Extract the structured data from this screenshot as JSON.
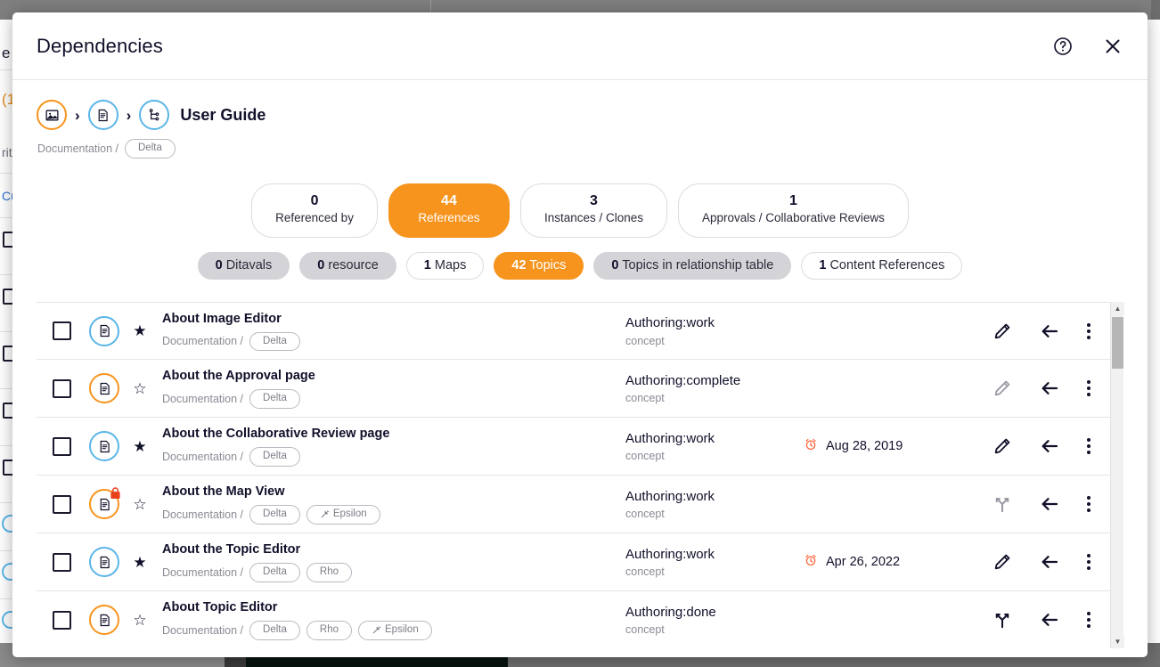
{
  "modal": {
    "title": "Dependencies",
    "help_icon": "help-circle-icon",
    "close_icon": "close-icon"
  },
  "breadcrumb": {
    "items": [
      {
        "icon": "image-icon",
        "ring": "#f7941e"
      },
      {
        "icon": "document-icon",
        "ring": "#5bb6e8"
      },
      {
        "icon": "map-branch-icon",
        "ring": "#5bb6e8"
      }
    ],
    "separator": "›",
    "title": "User Guide",
    "path": "Documentation /",
    "tag": "Delta"
  },
  "stats": [
    {
      "count": "0",
      "label": "Referenced by",
      "active": false
    },
    {
      "count": "44",
      "label": "References",
      "active": true
    },
    {
      "count": "3",
      "label": "Instances / Clones",
      "active": false
    },
    {
      "count": "1",
      "label": "Approvals / Collaborative Reviews",
      "active": false
    }
  ],
  "chips": [
    {
      "count": "0",
      "label": "Ditavals",
      "style": "grey"
    },
    {
      "count": "0",
      "label": "resource",
      "style": "grey"
    },
    {
      "count": "1",
      "label": "Maps",
      "style": "plain"
    },
    {
      "count": "42",
      "label": "Topics",
      "style": "orange"
    },
    {
      "count": "0",
      "label": "Topics in relationship table",
      "style": "grey"
    },
    {
      "count": "1",
      "label": "Content References",
      "style": "plain"
    }
  ],
  "table": {
    "rows": [
      {
        "name": "About Image Editor",
        "path": "Documentation /",
        "tags": [
          "Delta"
        ],
        "ring": "#5bb6e8",
        "locked": false,
        "starred": true,
        "status": "Authoring:work",
        "type": "concept",
        "date": "",
        "edit_enabled": true,
        "branch_enabled": false
      },
      {
        "name": "About the Approval page",
        "path": "Documentation /",
        "tags": [
          "Delta"
        ],
        "ring": "#f7941e",
        "locked": false,
        "starred": false,
        "status": "Authoring:complete",
        "type": "concept",
        "date": "",
        "edit_enabled": false,
        "branch_enabled": false
      },
      {
        "name": "About the Collaborative Review page",
        "path": "Documentation /",
        "tags": [
          "Delta"
        ],
        "ring": "#5bb6e8",
        "locked": false,
        "starred": true,
        "status": "Authoring:work",
        "type": "concept",
        "date": "Aug 28, 2019",
        "edit_enabled": true,
        "branch_enabled": false
      },
      {
        "name": "About the Map View",
        "path": "Documentation /",
        "tags": [
          "Delta",
          "Epsilon"
        ],
        "ring": "#f7941e",
        "locked": true,
        "starred": false,
        "status": "Authoring:work",
        "type": "concept",
        "date": "",
        "edit_enabled": false,
        "branch_enabled": false,
        "branch_dim": true
      },
      {
        "name": "About the Topic Editor",
        "path": "Documentation /",
        "tags": [
          "Delta",
          "Rho"
        ],
        "ring": "#5bb6e8",
        "locked": false,
        "starred": true,
        "status": "Authoring:work",
        "type": "concept",
        "date": "Apr 26, 2022",
        "edit_enabled": true,
        "branch_enabled": false
      },
      {
        "name": "About Topic Editor",
        "path": "Documentation /",
        "tags": [
          "Delta",
          "Rho",
          "Epsilon"
        ],
        "ring": "#f7941e",
        "locked": false,
        "starred": false,
        "status": "Authoring:done",
        "type": "concept",
        "date": "",
        "edit_enabled": false,
        "branch_enabled": true
      }
    ],
    "icons": {
      "edit": "pencil-icon",
      "branch": "branch-merge-icon",
      "back": "arrow-left-into-icon",
      "more": "kebab-menu-icon",
      "alarm": "alarm-clock-icon"
    }
  },
  "background": {
    "texts": [
      "e",
      "(1",
      "rite",
      "Cu"
    ]
  },
  "colors": {
    "accent_orange": "#f7941e",
    "accent_blue": "#5bb6e8",
    "text_dark": "#10102a",
    "muted": "#8a8a95",
    "alarm_red": "#ff5a2b"
  }
}
